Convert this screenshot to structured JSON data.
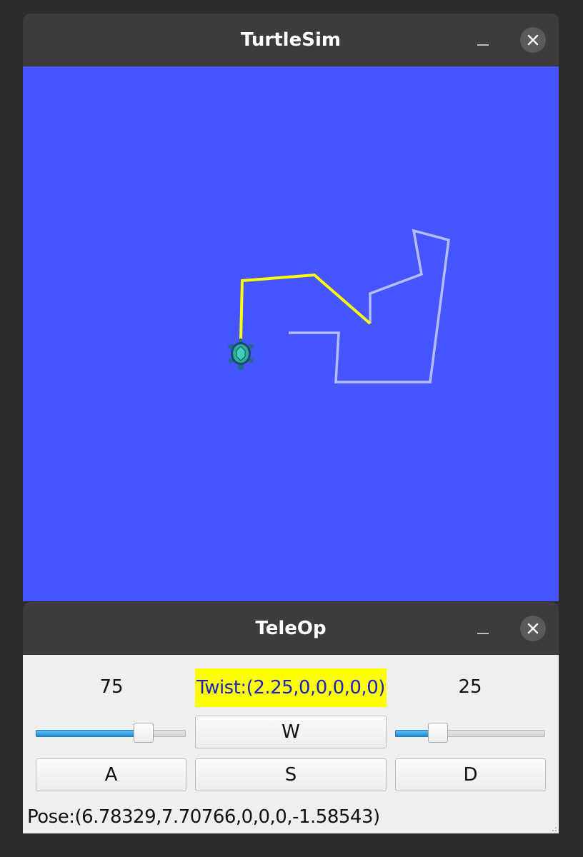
{
  "turtlesim": {
    "title": "TurtleSim",
    "background_color": "#4555ff",
    "pen_color_current": "#ffff00",
    "pen_color_previous": "#b5bdff"
  },
  "teleop": {
    "title": "TeleOp",
    "left_value": "75",
    "right_value": "25",
    "twist_text": "Twist:(2.25,0,0,0,0,0)",
    "buttons": {
      "w": "W",
      "a": "A",
      "s": "S",
      "d": "D"
    },
    "left_slider_fraction": 0.75,
    "right_slider_fraction": 0.25,
    "pose_text": "Pose:(6.78329,7.70766,0,0,0,-1.58543)",
    "accent_color": "#1e88d6"
  },
  "icons": {
    "minimize": "minimize-icon",
    "close": "close-icon",
    "turtle": "turtle-icon"
  }
}
